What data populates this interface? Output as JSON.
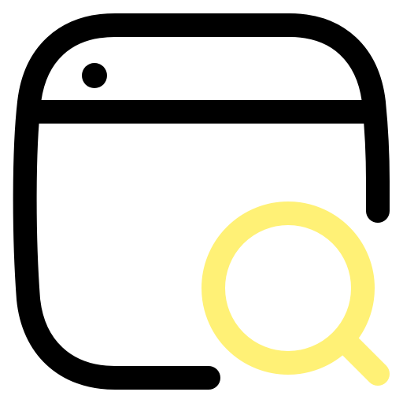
{
  "icon": {
    "name": "browser-window-search-icon",
    "colors": {
      "window_stroke": "#000000",
      "magnifier_stroke": "#FFF176",
      "background": "#FFFFFF"
    }
  }
}
